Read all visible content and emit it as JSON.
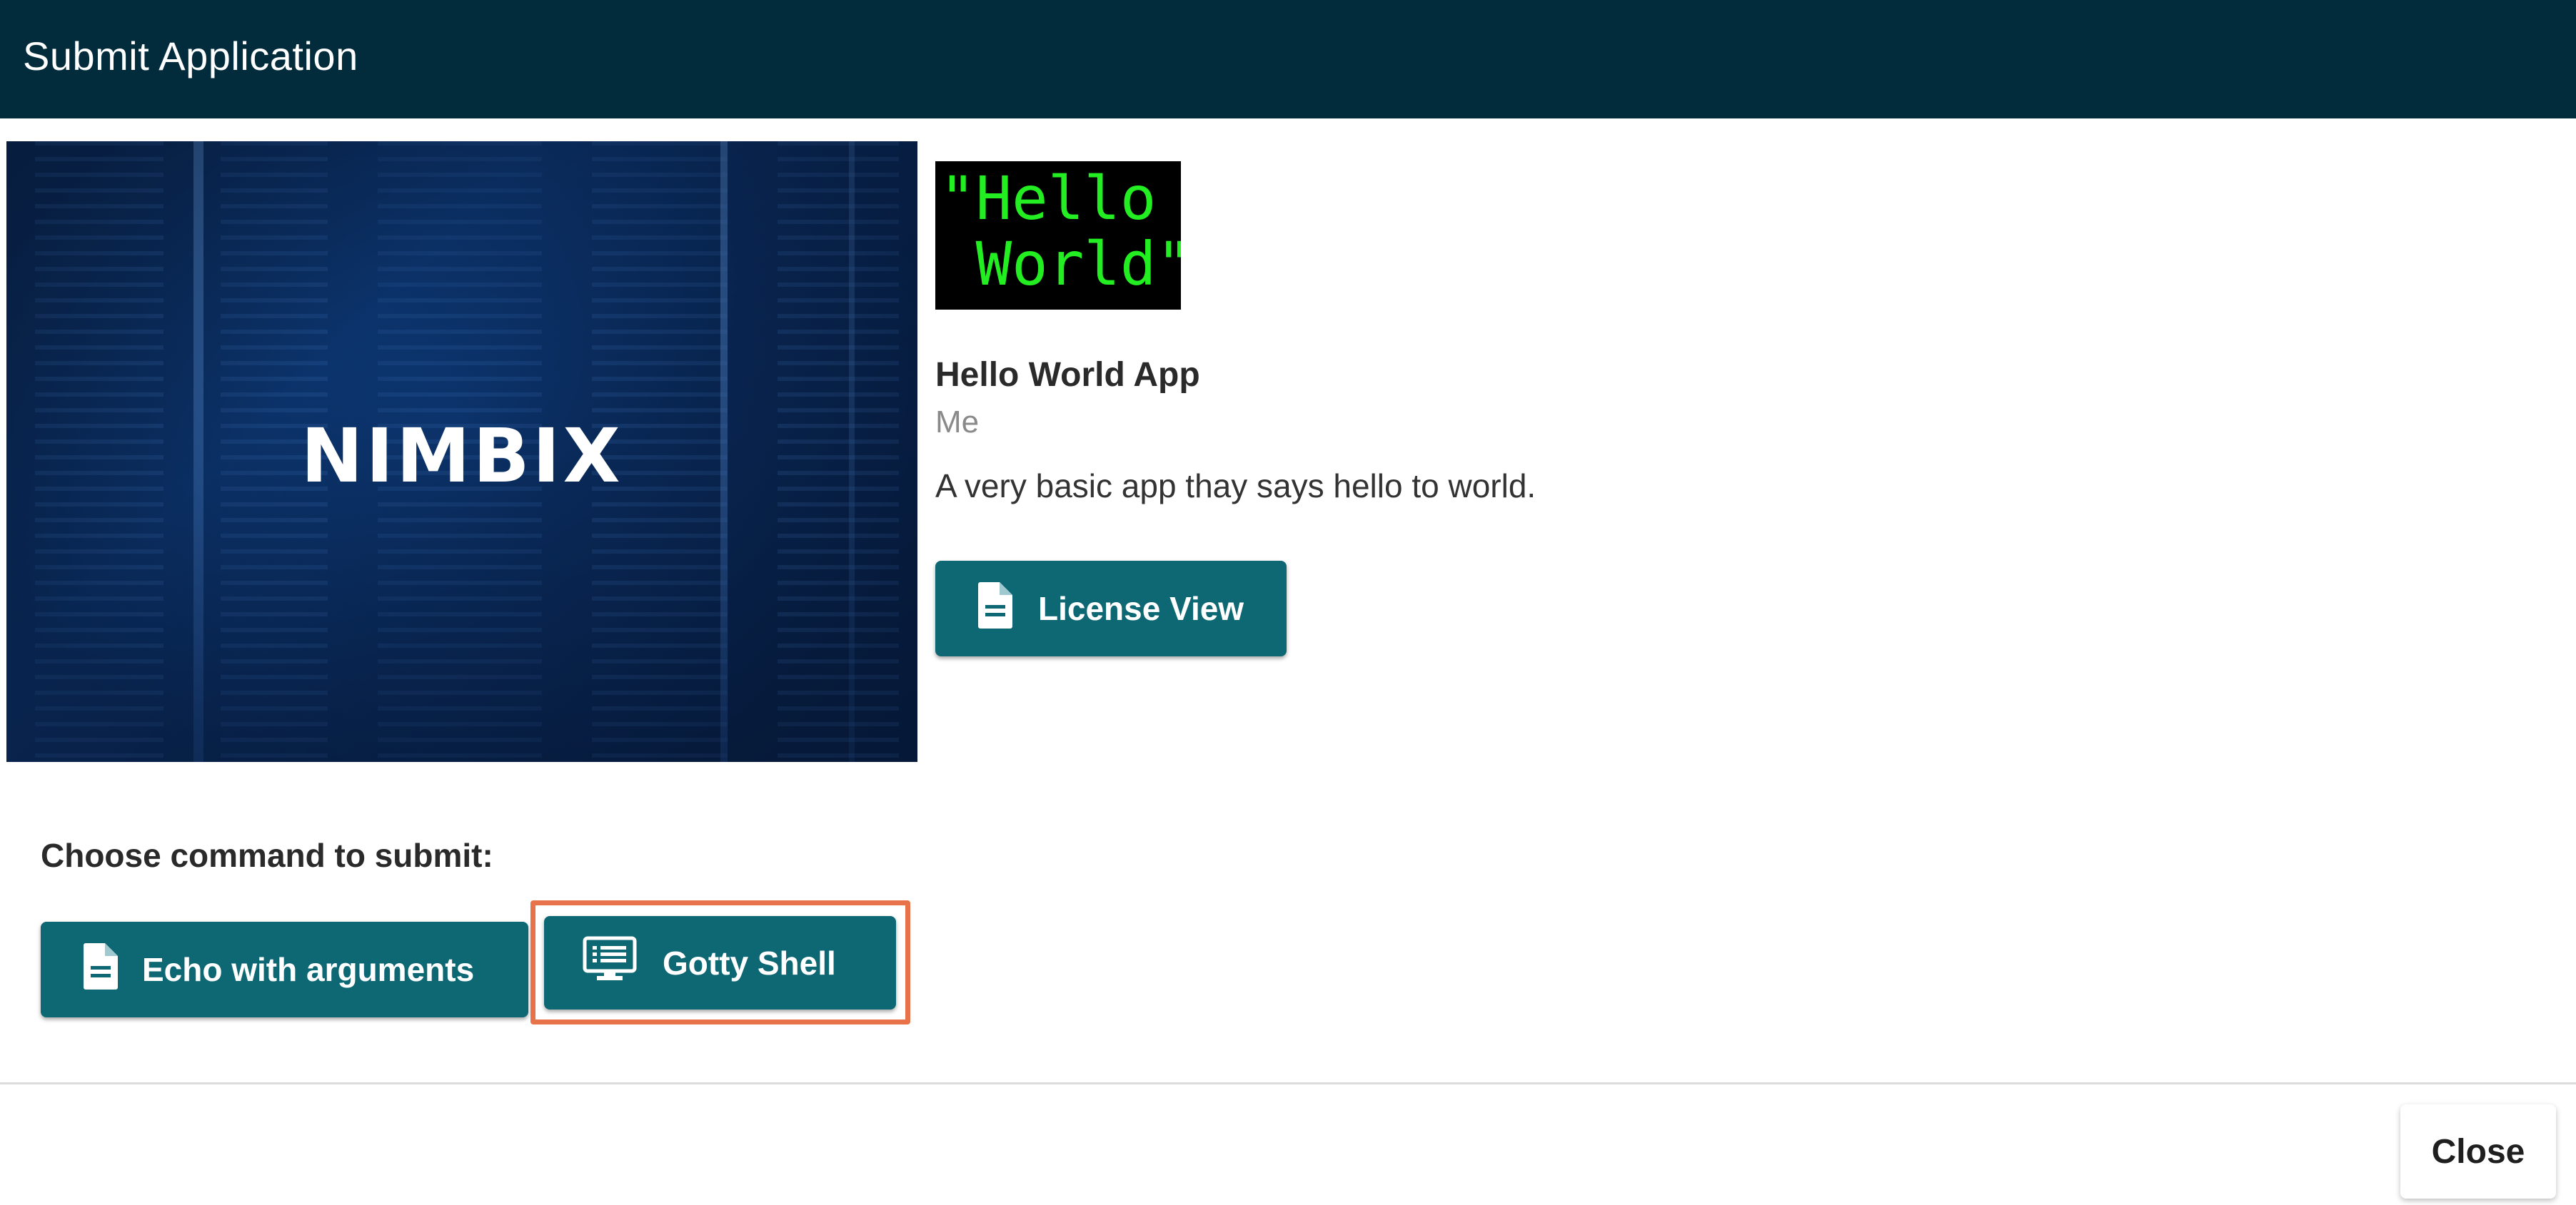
{
  "dialog": {
    "title": "Submit Application"
  },
  "hero": {
    "logo_text": "NIMBIX"
  },
  "app": {
    "icon_text": "\"Hello\n World\"",
    "name": "Hello World App",
    "owner": "Me",
    "description": "A very basic app thay says hello to world."
  },
  "license_button": {
    "label": "License View",
    "icon": "document-icon"
  },
  "commands": {
    "label": "Choose command to submit:",
    "items": [
      {
        "label": "Echo with arguments",
        "icon": "document-icon"
      },
      {
        "label": "Gotty Shell",
        "icon": "terminal-icon"
      }
    ]
  },
  "footer": {
    "close_label": "Close"
  },
  "colors": {
    "title_bar": "#022c3c",
    "button": "#0d6874",
    "highlight": "#e8734a",
    "icon_text": "#22ee22"
  }
}
